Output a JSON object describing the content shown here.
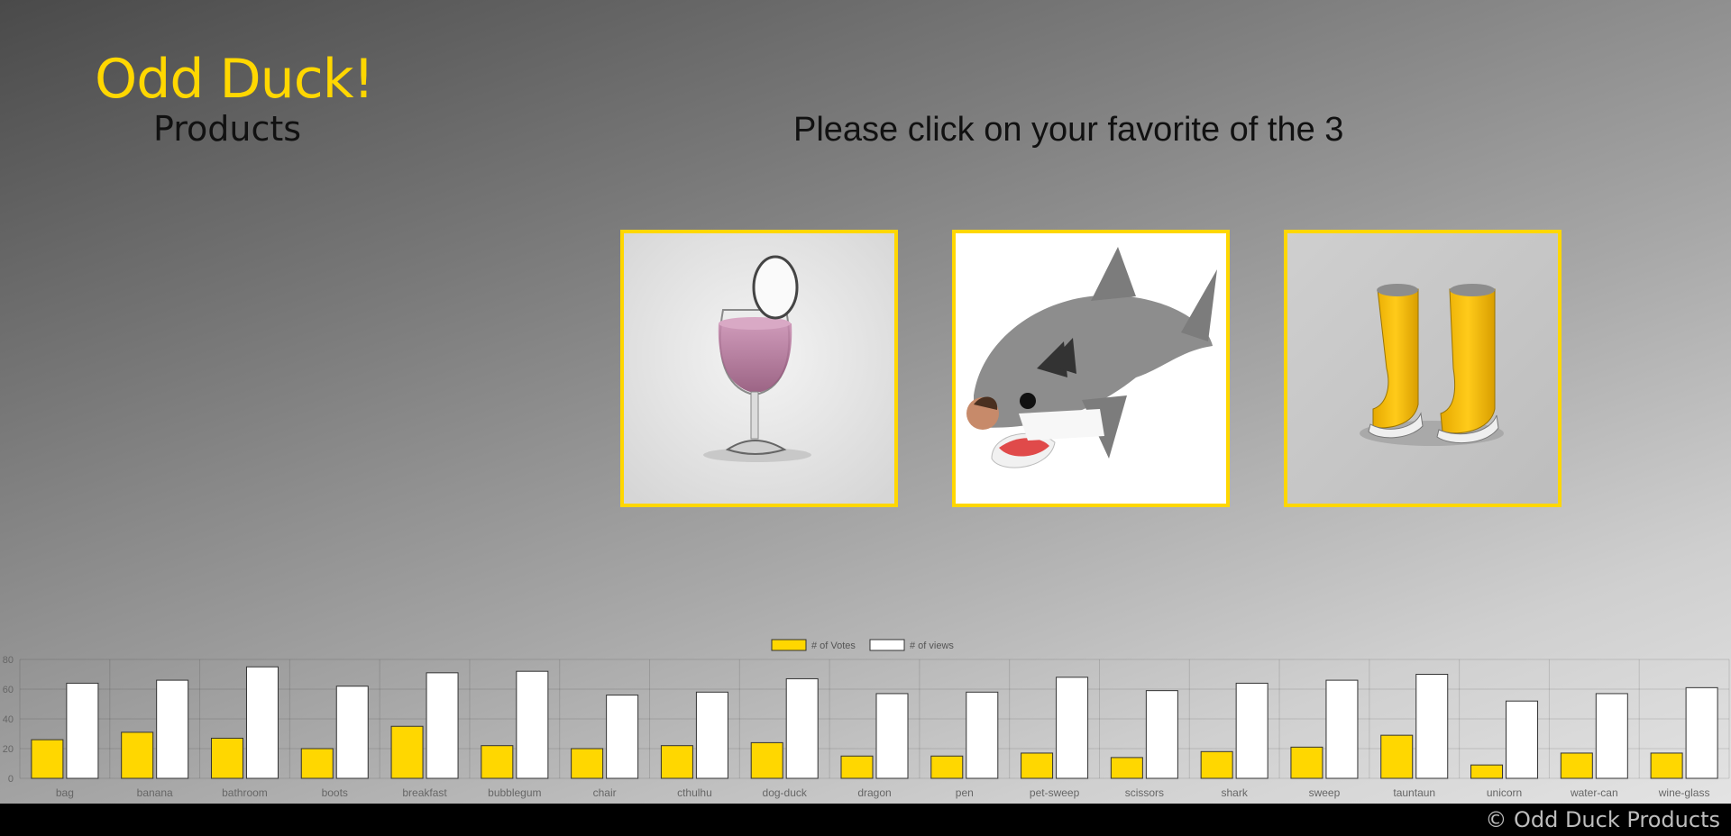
{
  "header": {
    "logo": "Odd Duck!",
    "subtitle": "Products"
  },
  "main": {
    "prompt": "Please click on your favorite of the 3",
    "products": [
      {
        "name": "wine-glass"
      },
      {
        "name": "shark"
      },
      {
        "name": "boots"
      }
    ]
  },
  "chart_data": {
    "type": "bar",
    "categories": [
      "bag",
      "banana",
      "bathroom",
      "boots",
      "breakfast",
      "bubblegum",
      "chair",
      "cthulhu",
      "dog-duck",
      "dragon",
      "pen",
      "pet-sweep",
      "scissors",
      "shark",
      "sweep",
      "tauntaun",
      "unicorn",
      "water-can",
      "wine-glass"
    ],
    "series": [
      {
        "name": "# of Votes",
        "color": "#FFD700",
        "values": [
          26,
          31,
          27,
          20,
          35,
          22,
          20,
          22,
          24,
          15,
          15,
          17,
          14,
          18,
          21,
          29,
          9,
          17,
          17
        ]
      },
      {
        "name": "# of views",
        "color": "#FFFFFF",
        "values": [
          64,
          66,
          75,
          62,
          71,
          72,
          56,
          58,
          67,
          57,
          58,
          68,
          59,
          64,
          66,
          70,
          52,
          57,
          61
        ]
      }
    ],
    "ylim": [
      0,
      80
    ],
    "yticks": [
      0,
      20,
      40,
      60,
      80
    ],
    "grid": true,
    "legend": "top"
  },
  "footer": {
    "copyright": "© Odd Duck Products"
  }
}
